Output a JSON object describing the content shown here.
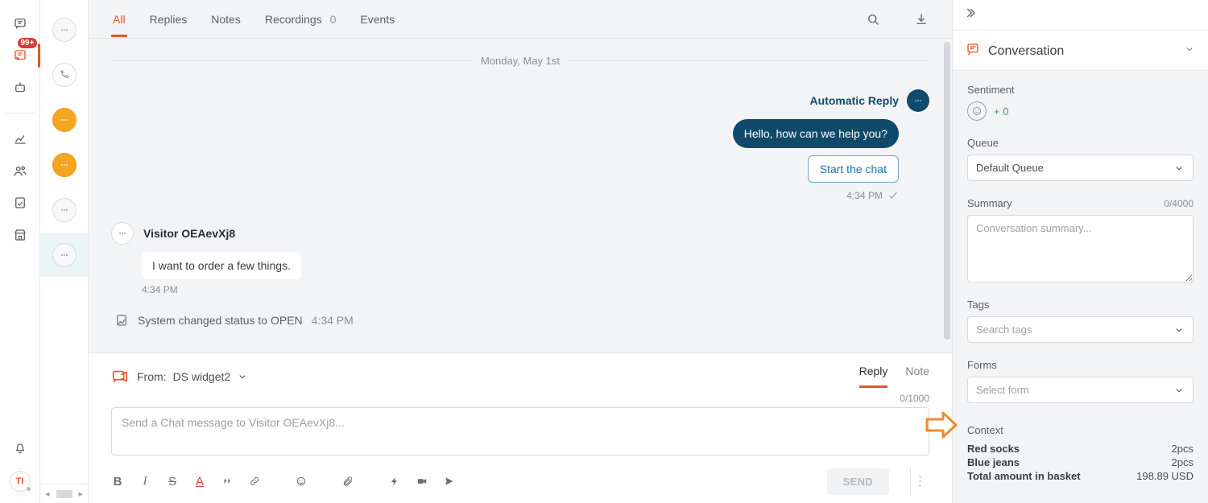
{
  "rail": {
    "badge": "99+",
    "avatar_initials": "TI"
  },
  "tabs": {
    "all": "All",
    "replies": "Replies",
    "notes": "Notes",
    "recordings": "Recordings",
    "recordings_count": "0",
    "events": "Events"
  },
  "thread": {
    "date": "Monday, May 1st",
    "auto_reply_label": "Automatic Reply",
    "auto_reply_text": "Hello, how can we help you?",
    "start_chat_btn": "Start the chat",
    "auto_time": "4:34 PM",
    "visitor_name": "Visitor OEAevXj8",
    "visitor_text": "I want to order a few things.",
    "visitor_time": "4:34 PM",
    "system_text": "System changed status to OPEN",
    "system_time": "4:34 PM"
  },
  "composer": {
    "from_prefix": "From:",
    "from_value": "DS widget2",
    "tab_reply": "Reply",
    "tab_note": "Note",
    "counter": "0/1000",
    "placeholder": "Send a Chat message to Visitor OEAevXj8...",
    "send": "SEND"
  },
  "details": {
    "title": "Conversation",
    "sentiment_label": "Sentiment",
    "sentiment_value": "+ 0",
    "queue_label": "Queue",
    "queue_value": "Default Queue",
    "summary_label": "Summary",
    "summary_counter": "0/4000",
    "summary_placeholder": "Conversation summary...",
    "tags_label": "Tags",
    "tags_placeholder": "Search tags",
    "forms_label": "Forms",
    "forms_placeholder": "Select form",
    "context_label": "Context",
    "context": [
      {
        "k": "Red socks",
        "v": "2pcs"
      },
      {
        "k": "Blue jeans",
        "v": "2pcs"
      },
      {
        "k": "Total amount in basket",
        "v": "198.89 USD"
      }
    ]
  }
}
